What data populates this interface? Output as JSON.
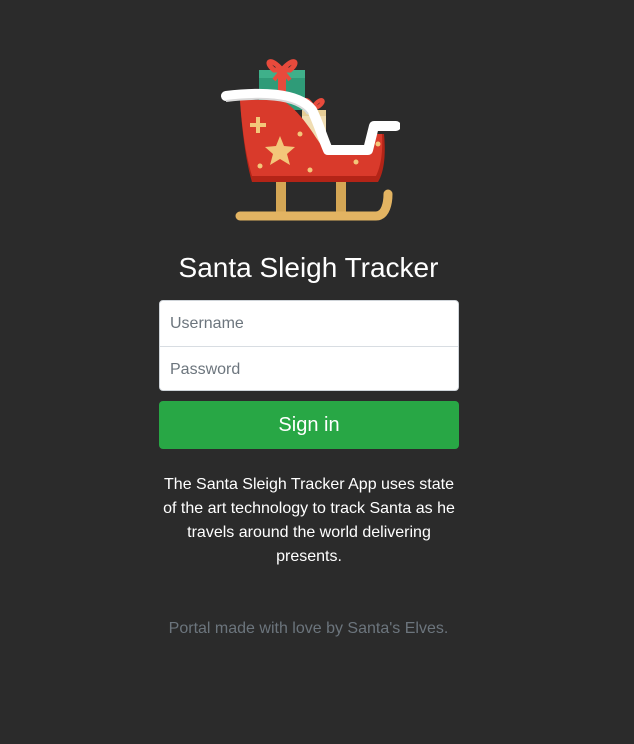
{
  "app": {
    "title": "Santa Sleigh Tracker",
    "logo_icon": "sleigh-icon"
  },
  "login": {
    "username_placeholder": "Username",
    "username_value": "",
    "password_placeholder": "Password",
    "password_value": "",
    "signin_label": "Sign in"
  },
  "description": "The Santa Sleigh Tracker App uses state of the art technology to track Santa as he travels around the world delivering presents.",
  "footer": "Portal made with love by Santa's Elves.",
  "colors": {
    "background": "#2b2b2b",
    "button": "#28a745",
    "sleigh_body": "#d93a2b",
    "runner": "#e3b462"
  }
}
